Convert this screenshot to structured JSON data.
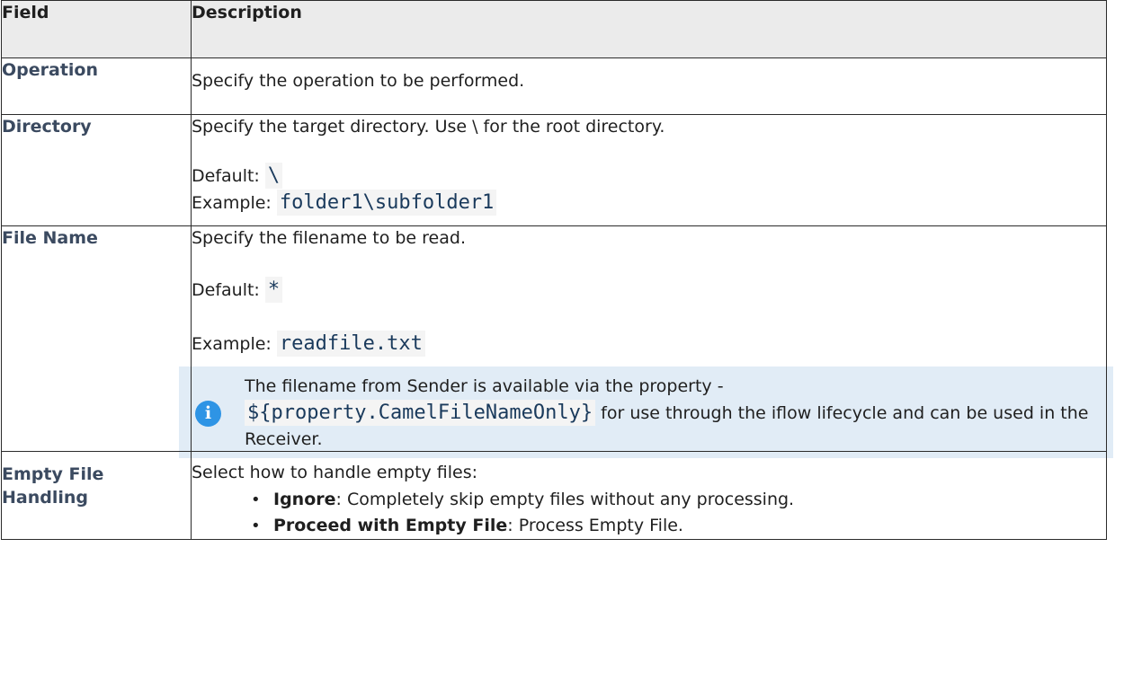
{
  "header": {
    "field": "Field",
    "description": "Description"
  },
  "rows": {
    "operation": {
      "field": "Operation",
      "desc": "Specify the operation to be performed."
    },
    "directory": {
      "field": "Directory",
      "desc": "Specify the target directory. Use \\ for the root directory.",
      "default_label": "Default:",
      "default_value": "\\",
      "example_label": "Example:",
      "example_value": "folder1\\subfolder1"
    },
    "file_name": {
      "field": "File Name",
      "desc": "Specify the filename to be read.",
      "default_label": "Default:",
      "default_value": "*",
      "example_label": "Example:",
      "example_value": "readfile.txt",
      "note": {
        "icon": "info-icon",
        "text_before": "The filename from Sender is available via the property -",
        "code": "${property.CamelFileNameOnly}",
        "text_after": "for use through the iflow lifecycle and can be used in the Receiver."
      }
    },
    "empty_file": {
      "field_line1": "Empty File",
      "field_line2": "Handling",
      "desc": "Select how to handle empty files:",
      "options": [
        {
          "term": "Ignore",
          "text": ": Completely skip empty files without any processing."
        },
        {
          "term": "Proceed with Empty File",
          "text": ": Process Empty File."
        }
      ]
    }
  }
}
